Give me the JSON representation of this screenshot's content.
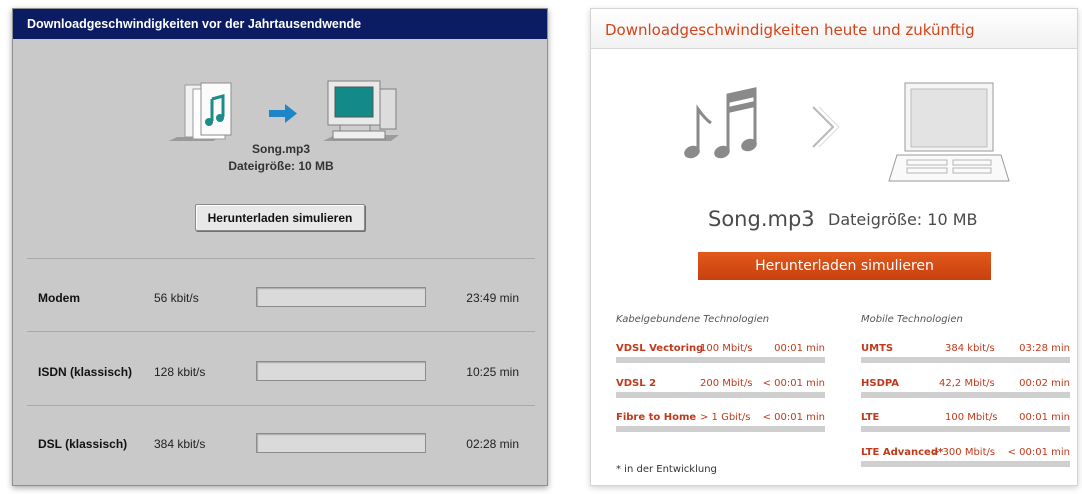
{
  "legacy": {
    "title": "Downloadgeschwindigkeiten vor der Jahrtausendwende",
    "file_name": "Song.mp3",
    "file_size": "Dateigröße: 10 MB",
    "simulate_label": "Herunterladen simulieren",
    "rows": [
      {
        "name": "Modem",
        "speed": "56 kbit/s",
        "time": "23:49 min"
      },
      {
        "name": "ISDN (klassisch)",
        "speed": "128 kbit/s",
        "time": "10:25 min"
      },
      {
        "name": "DSL (klassisch)",
        "speed": "384 kbit/s",
        "time": "02:28 min"
      }
    ]
  },
  "modern": {
    "title": "Downloadgeschwindigkeiten heute und zukünftig",
    "file_name": "Song.mp3",
    "file_size": "Dateigröße: 10 MB",
    "simulate_label": "Herunterladen simulieren",
    "wired_title": "Kabelgebundene Technologien",
    "mobile_title": "Mobile Technologien",
    "wired": [
      {
        "name": "VDSL Vectoring",
        "speed": "100 Mbit/s",
        "time": "00:01 min"
      },
      {
        "name": "VDSL 2",
        "speed": "200 Mbit/s",
        "time": "< 00:01 min"
      },
      {
        "name": "Fibre to Home",
        "speed": "> 1 Gbit/s",
        "time": "< 00:01 min"
      }
    ],
    "mobile": [
      {
        "name": "UMTS",
        "speed": "384 kbit/s",
        "time": "03:28 min"
      },
      {
        "name": "HSDPA",
        "speed": "42,2 Mbit/s",
        "time": "00:02 min"
      },
      {
        "name": "LTE",
        "speed": "100 Mbit/s",
        "time": "00:01 min"
      },
      {
        "name": "LTE Advanced*",
        "speed": "> 300 Mbit/s",
        "time": "< 00:01 min"
      }
    ],
    "footnote": "* in der Entwicklung"
  },
  "colors": {
    "legacy_title_bar": "#0c1c63",
    "legacy_panel": "#c9c9c9",
    "modern_accent": "#d4441a",
    "modern_button": "#d44b16"
  },
  "icons": {
    "legacy": [
      "music-file-icon",
      "arrow-right-icon",
      "computer-icon"
    ],
    "modern": [
      "music-notes-icon",
      "chevron-right-icon",
      "laptop-icon"
    ]
  }
}
